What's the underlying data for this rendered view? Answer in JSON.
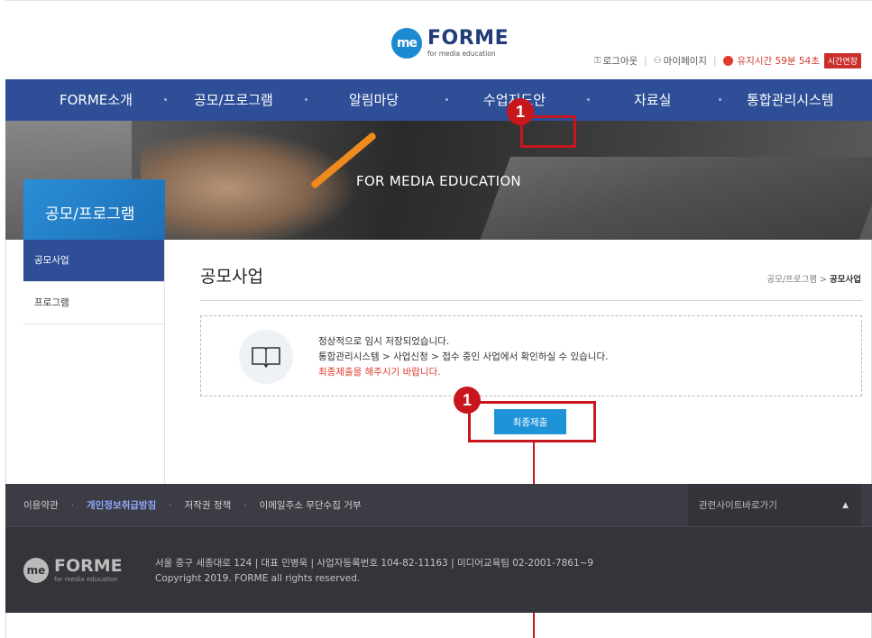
{
  "header": {
    "logo_mark": "me",
    "logo_title": "FORME",
    "logo_sub": "for media education",
    "logout": "로그아웃",
    "mypage": "마이페이지",
    "session_timer": "유지시간 59분 54초",
    "extend_button": "시간연장"
  },
  "nav": {
    "items": [
      "FORME소개",
      "공모/프로그램",
      "알림마당",
      "수업지도안",
      "자료실",
      "통합관리시스템"
    ]
  },
  "hero": {
    "title": "FOR MEDIA EDUCATION",
    "section": "공모/프로그램"
  },
  "sidebar": {
    "items": [
      {
        "label": "공모사업",
        "active": true
      },
      {
        "label": "프로그램",
        "active": false
      }
    ]
  },
  "content": {
    "title": "공모사업",
    "breadcrumb_parent": "공모/프로그램",
    "breadcrumb_sep": " > ",
    "breadcrumb_current": "공모사업",
    "notice_line1": "정상적으로 임시 저장되었습니다.",
    "notice_line2": "통합관리시스템 > 사업신청 > 접수 중인 사업에서 확인하실 수 있습니다.",
    "notice_line3": "최종제출을 해주시기 바랍니다.",
    "submit_button": "최종제출"
  },
  "annotations": {
    "badge_1": "1",
    "badge_2": "1",
    "color": "#c8161d"
  },
  "footer": {
    "links": [
      "이용약관",
      "개인정보취급방침",
      "저작권 정책",
      "이메일주소 무단수집 거부"
    ],
    "related_sites": "관련사이트바로가기",
    "related_arrow": "▲",
    "logo_mark": "me",
    "logo_title": "FORME",
    "logo_sub": "for media education",
    "address_line": "서울 중구 세종대로 124  |  대표 민병욱  |  사업자등록번호 104-82-11163  |  미디어교육팀 02-2001-7861~9",
    "copyright": "Copyright 2019. FORME all rights reserved."
  },
  "colors": {
    "nav_bg": "#2e4f98",
    "accent_blue": "#1f93d8",
    "alert_red": "#e03a2b",
    "footer_bg": "#3c3c44"
  }
}
